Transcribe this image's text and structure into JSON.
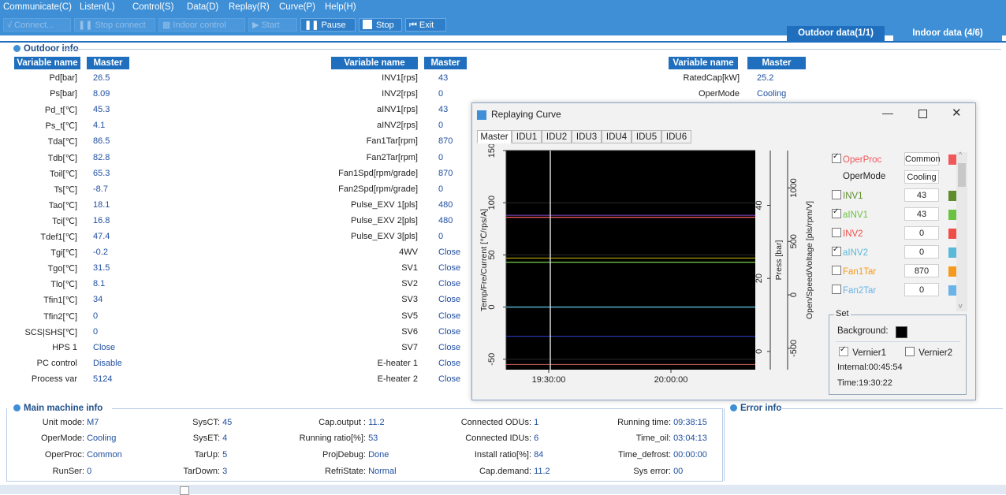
{
  "menu": [
    "Communicate(C)",
    "Listen(L)",
    "Control(S)",
    "Data(D)",
    "Replay(R)",
    "Curve(P)",
    "Help(H)"
  ],
  "toolbar": {
    "connect": "Connect...",
    "stop_connect": "Stop connect",
    "indoor_control": "Indoor control",
    "start": "Start",
    "pause": "Pause",
    "stop": "Stop",
    "exit": "Exit"
  },
  "top_tabs": {
    "outdoor": "Outdoor data(1/1)",
    "indoor": "Indoor data  (4/6)"
  },
  "outdoor": {
    "title": "Outdoor info",
    "col_header_name": "Variable name",
    "col_header_master": "Master",
    "col1": [
      {
        "name": "Pd[bar]",
        "value": "26.5"
      },
      {
        "name": "Ps[bar]",
        "value": "8.09"
      },
      {
        "name": "Pd_t[℃]",
        "value": "45.3"
      },
      {
        "name": "Ps_t[℃]",
        "value": "4.1"
      },
      {
        "name": "Tda[℃]",
        "value": "86.5"
      },
      {
        "name": "Tdb[℃]",
        "value": "82.8"
      },
      {
        "name": "Toil[℃]",
        "value": "65.3"
      },
      {
        "name": "Ts[℃]",
        "value": "-8.7"
      },
      {
        "name": "Tao[℃]",
        "value": "18.1"
      },
      {
        "name": "Tci[℃]",
        "value": "16.8"
      },
      {
        "name": "Tdef1[℃]",
        "value": "47.4"
      },
      {
        "name": "Tgi[℃]",
        "value": "-0.2"
      },
      {
        "name": "Tgo[℃]",
        "value": "31.5"
      },
      {
        "name": "Tlo[℃]",
        "value": "8.1"
      },
      {
        "name": "Tfin1[℃]",
        "value": "34"
      },
      {
        "name": "Tfin2[℃]",
        "value": "0"
      },
      {
        "name": "SCS|SHS[℃]",
        "value": "0"
      },
      {
        "name": "HPS 1",
        "value": "Close"
      },
      {
        "name": "PC control",
        "value": "Disable"
      },
      {
        "name": "Process var",
        "value": "5124"
      }
    ],
    "col2": [
      {
        "name": "INV1[rps]",
        "value": "43"
      },
      {
        "name": "INV2[rps]",
        "value": "0"
      },
      {
        "name": "aINV1[rps]",
        "value": "43"
      },
      {
        "name": "aINV2[rps]",
        "value": "0"
      },
      {
        "name": "Fan1Tar[rpm]",
        "value": "870"
      },
      {
        "name": "Fan2Tar[rpm]",
        "value": "0"
      },
      {
        "name": "Fan1Spd[rpm/grade]",
        "value": "870"
      },
      {
        "name": "Fan2Spd[rpm/grade]",
        "value": "0"
      },
      {
        "name": "Pulse_EXV 1[pls]",
        "value": "480"
      },
      {
        "name": "Pulse_EXV 2[pls]",
        "value": "480"
      },
      {
        "name": "Pulse_EXV 3[pls]",
        "value": "0"
      },
      {
        "name": "4WV",
        "value": "Close"
      },
      {
        "name": "SV1",
        "value": "Close"
      },
      {
        "name": "SV2",
        "value": "Close"
      },
      {
        "name": "SV3",
        "value": "Close"
      },
      {
        "name": "SV5",
        "value": "Close"
      },
      {
        "name": "SV6",
        "value": "Close"
      },
      {
        "name": "SV7",
        "value": "Close"
      },
      {
        "name": "E-heater 1",
        "value": "Close"
      },
      {
        "name": "E-heater 2",
        "value": "Close"
      }
    ],
    "col3": [
      {
        "name": "RatedCap[kW]",
        "value": "25.2"
      },
      {
        "name": "OperMode",
        "value": "Cooling"
      }
    ]
  },
  "main_machine": {
    "title": "Main machine info",
    "items": [
      {
        "label": "Unit mode:",
        "value": "M7"
      },
      {
        "label": "OperMode:",
        "value": "Cooling"
      },
      {
        "label": "OperProc:",
        "value": "Common"
      },
      {
        "label": "RunSer:",
        "value": "0"
      },
      {
        "label": "SysCT:",
        "value": "45"
      },
      {
        "label": "SysET:",
        "value": "4"
      },
      {
        "label": "TarUp:",
        "value": "5"
      },
      {
        "label": "TarDown:",
        "value": "3"
      },
      {
        "label": "Cap.output :",
        "value": "11.2"
      },
      {
        "label": "Running ratio[%]:",
        "value": "53"
      },
      {
        "label": "ProjDebug:",
        "value": "Done"
      },
      {
        "label": "RefriState:",
        "value": "Normal"
      },
      {
        "label": "Connected ODUs:",
        "value": "1"
      },
      {
        "label": "Connected IDUs:",
        "value": "6"
      },
      {
        "label": "Install ratio[%]:",
        "value": "84"
      },
      {
        "label": "Cap.demand:",
        "value": "11.2"
      },
      {
        "label": "Running time:",
        "value": "09:38:15"
      },
      {
        "label": "Time_oil:",
        "value": "03:04:13"
      },
      {
        "label": "Time_defrost:",
        "value": "00:00:00"
      },
      {
        "label": "Sys error:",
        "value": "00"
      }
    ]
  },
  "error_info": {
    "title": "Error info"
  },
  "popup": {
    "title": "Replaying Curve",
    "tabs": [
      "Master",
      "IDU1",
      "IDU2",
      "IDU3",
      "IDU4",
      "IDU5",
      "IDU6"
    ],
    "active_tab": "Master",
    "y_left_label": "Temp/Fre/Current [℃/rps/A]",
    "y_press_label": "Press [bar]",
    "y_right_label": "Open/Speed/Voltage [pls/rpm/V]",
    "y_left_ticks": [
      "150",
      "100",
      "50",
      "0",
      "-50"
    ],
    "y_press_ticks": [
      "40",
      "20",
      "0"
    ],
    "y_right_ticks": [
      "1000",
      "500",
      "0",
      "-500"
    ],
    "x_ticks": [
      "19:30:00",
      "20:00:00"
    ],
    "legend": [
      {
        "name": "OperProc",
        "value": "Common",
        "checked": true,
        "color": "#f0575b"
      },
      {
        "name": "OperMode",
        "value": "Cooling",
        "checked": null,
        "color": ""
      },
      {
        "name": "INV1",
        "value": "43",
        "checked": false,
        "color": "#5f8c2c"
      },
      {
        "name": "aINV1",
        "value": "43",
        "checked": true,
        "color": "#6bc140"
      },
      {
        "name": "INV2",
        "value": "0",
        "checked": false,
        "color": "#ef4e47"
      },
      {
        "name": "aINV2",
        "value": "0",
        "checked": true,
        "color": "#5ab9d8"
      },
      {
        "name": "Fan1Tar",
        "value": "870",
        "checked": false,
        "color": "#f59a1f"
      },
      {
        "name": "Fan2Tar",
        "value": "0",
        "checked": false,
        "color": "#6ab3e8"
      }
    ],
    "set_title": "Set",
    "background_label": "Background:",
    "background_color": "#000000",
    "vernier1": "Vernier1",
    "vernier2": "Vernier2",
    "internal": "Internal:00:45:54",
    "time": "Time:19:30:22"
  },
  "chart_data": {
    "type": "line",
    "x_ticks": [
      "19:30:00",
      "20:00:00"
    ],
    "ylim_left": [
      -60,
      150
    ],
    "series": [
      {
        "name": "OperProc",
        "color": "#f0575b",
        "values": [
          86,
          86
        ]
      },
      {
        "name": "aINV1",
        "color": "#6bc140",
        "values": [
          43,
          43
        ]
      },
      {
        "name": "aINV2",
        "color": "#5ab9d8",
        "values": [
          0,
          0
        ]
      }
    ],
    "vernier_x": "19:30:22",
    "background": "#000000"
  }
}
